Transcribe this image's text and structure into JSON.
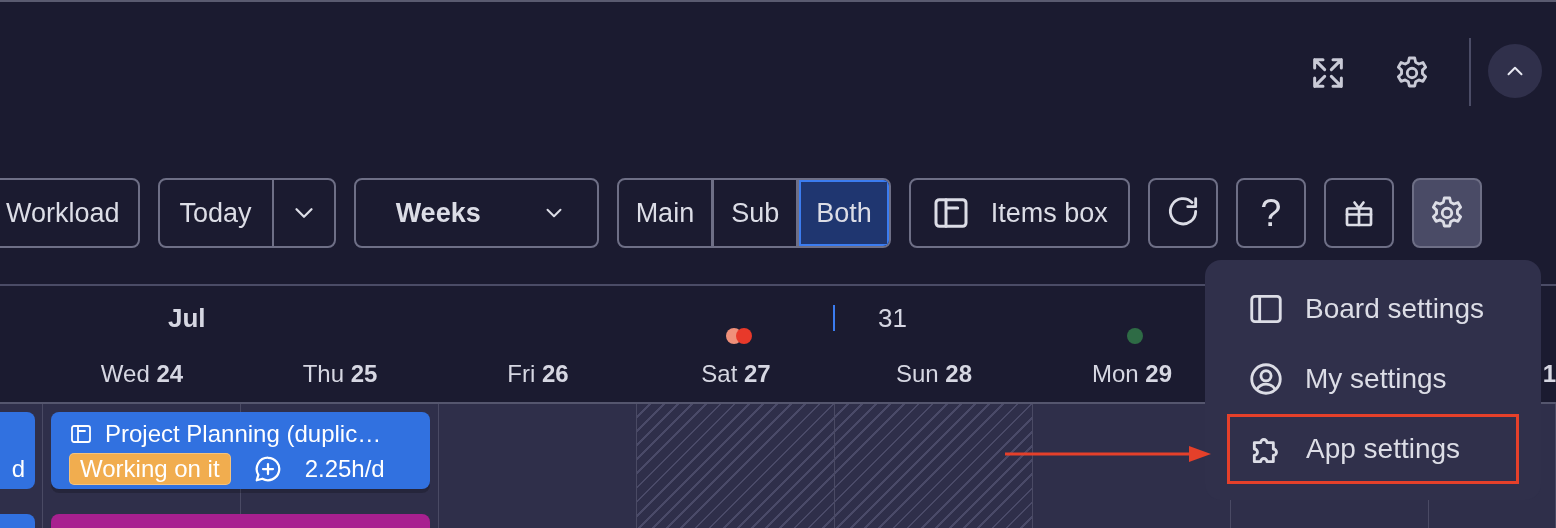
{
  "header_icons": [
    {
      "kind": "expand"
    },
    {
      "kind": "settings"
    }
  ],
  "collapse_button": {
    "kind": "chevron-up"
  },
  "toolbar": {
    "view_button": "Workload",
    "today": "Today",
    "range": "Weeks",
    "segments": [
      {
        "label": "Main",
        "selected": false
      },
      {
        "label": "Sub",
        "selected": false
      },
      {
        "label": "Both",
        "selected": true
      }
    ],
    "items_box": "Items box",
    "icon_buttons": [
      {
        "kind": "refresh",
        "selected": false
      },
      {
        "kind": "help",
        "label": "?",
        "selected": false
      },
      {
        "kind": "gift",
        "selected": false
      },
      {
        "kind": "settings",
        "selected": true
      }
    ]
  },
  "calendar": {
    "month": "Jul",
    "week": "31",
    "days": [
      {
        "name": "Wed",
        "num": "24",
        "weekend": false
      },
      {
        "name": "Thu",
        "num": "25",
        "weekend": false
      },
      {
        "name": "Fri",
        "num": "26",
        "weekend": false
      },
      {
        "name": "Sat",
        "num": "27",
        "weekend": true,
        "dots": [
          {
            "color": "#f0907a"
          },
          {
            "color": "#e8392a"
          }
        ]
      },
      {
        "name": "Sun",
        "num": "28",
        "weekend": true
      },
      {
        "name": "Mon",
        "num": "29",
        "weekend": false,
        "dots": [
          {
            "color": "#2e6b45"
          }
        ]
      },
      {
        "weekend": false
      },
      {
        "num": "1",
        "weekend": false
      }
    ],
    "events": [
      {
        "kind": "stub",
        "text": "d",
        "color": "#3171e0"
      },
      {
        "kind": "card",
        "title": "Project Planning (duplic…",
        "status": {
          "label": "Working on it",
          "color": "#f1ad4f"
        },
        "rate": "2.25h/d",
        "color": "#3171e0"
      },
      {
        "kind": "stub",
        "color": "#3171e0"
      },
      {
        "kind": "bar",
        "color": "#a8208f"
      }
    ]
  },
  "menu": {
    "items": [
      {
        "kind": "board",
        "label": "Board settings",
        "highlighted": false
      },
      {
        "kind": "user",
        "label": "My settings",
        "highlighted": false
      },
      {
        "kind": "puzzle",
        "label": "App settings",
        "highlighted": true
      }
    ]
  }
}
